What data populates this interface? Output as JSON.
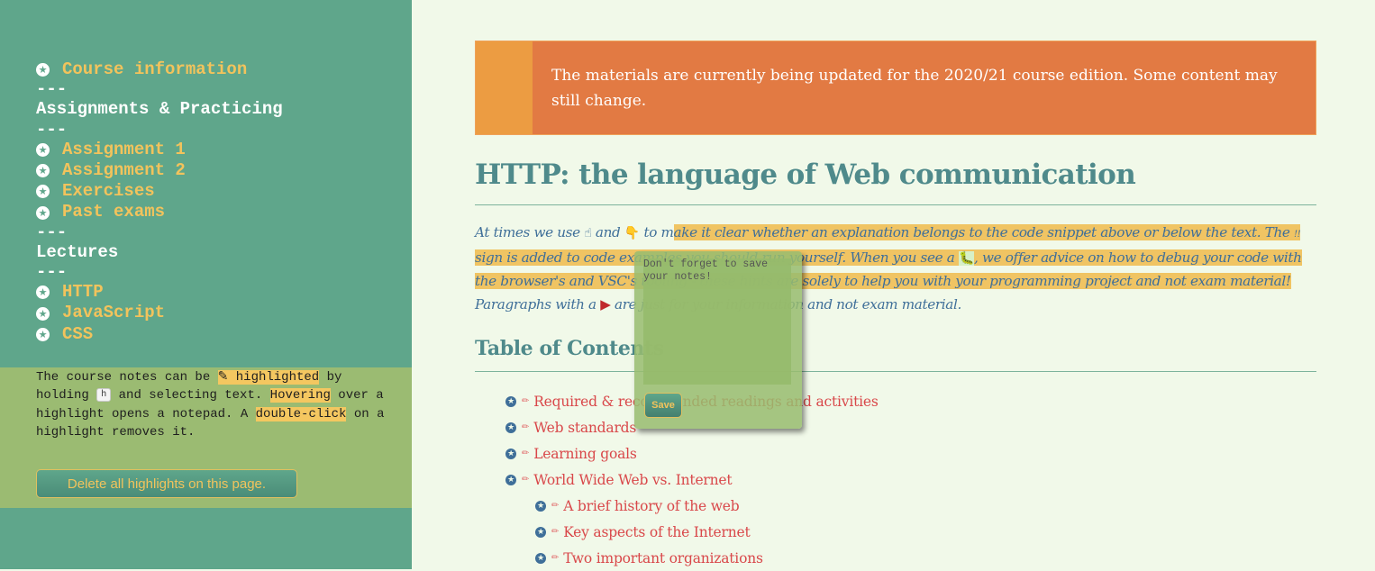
{
  "sidebar": {
    "nav": [
      {
        "type": "link",
        "label": "Course information"
      },
      {
        "type": "sep",
        "label": "---"
      },
      {
        "type": "heading",
        "label": "Assignments & Practicing"
      },
      {
        "type": "sep",
        "label": "---"
      },
      {
        "type": "link",
        "label": "Assignment 1"
      },
      {
        "type": "link",
        "label": "Assignment 2"
      },
      {
        "type": "link",
        "label": "Exercises"
      },
      {
        "type": "link",
        "label": "Past exams"
      },
      {
        "type": "sep",
        "label": "---"
      },
      {
        "type": "heading",
        "label": "Lectures"
      },
      {
        "type": "sep",
        "label": "---"
      },
      {
        "type": "link",
        "label": "HTTP"
      },
      {
        "type": "link",
        "label": "JavaScript"
      },
      {
        "type": "link",
        "label": "CSS"
      }
    ],
    "highlight_info": {
      "t1": "The course notes can be ",
      "m1": "✎ highlighted",
      "t2": " by holding ",
      "key": "h",
      "t3": " and selecting text. ",
      "m2": "Hovering",
      "t4": " over a highlight opens a notepad. A ",
      "m3": "double-click",
      "t5": " on a highlight removes it."
    },
    "delete_button": "Delete all highlights on this page."
  },
  "banner": {
    "text": "The materials are currently being updated for the 2020/21 course edition. Some content may still change."
  },
  "main": {
    "title": "HTTP: the language of Web communication",
    "intro": {
      "p1": "At times we use ",
      "emoji_up": "☝",
      "p2": " and ",
      "emoji_down": "👇",
      "p3": " to m",
      "h1": "ake it clear whether an explanation belongs to the code snippet above or below the text. The ",
      "bang": "!!",
      "h2": " sign is added to code examples you should run yourself. When you see a ",
      "bug": "🐛",
      "h3": ", we offer advice on how to debug your code with the browser's and VSC's tooling - these hints are solely to help you with your programming project and not exam material!",
      "p4": " Paragraphs with a ",
      "flag": "▶",
      "p5": " are just for your information and not exam material."
    },
    "toc_title": "Table of Contents",
    "toc": [
      {
        "label": "Required & recommended readings and activities",
        "level": 1
      },
      {
        "label": "Web standards",
        "level": 1
      },
      {
        "label": "Learning goals",
        "level": 1
      },
      {
        "label": "World Wide Web vs. Internet",
        "level": 1
      },
      {
        "label": "A brief history of the web",
        "level": 2
      },
      {
        "label": "Key aspects of the Internet",
        "level": 2
      },
      {
        "label": "Two important organizations",
        "level": 2
      }
    ]
  },
  "notepad": {
    "text": "Don't forget to save your notes!",
    "save_label": "Save"
  },
  "colors": {
    "sidebar_bg": "#5fa68b",
    "link_yellow": "#f2c35c",
    "highlight": "#f0c463",
    "banner_orange": "#e27a43",
    "title_teal": "#4f8a8b",
    "toc_red": "#d9484a"
  }
}
